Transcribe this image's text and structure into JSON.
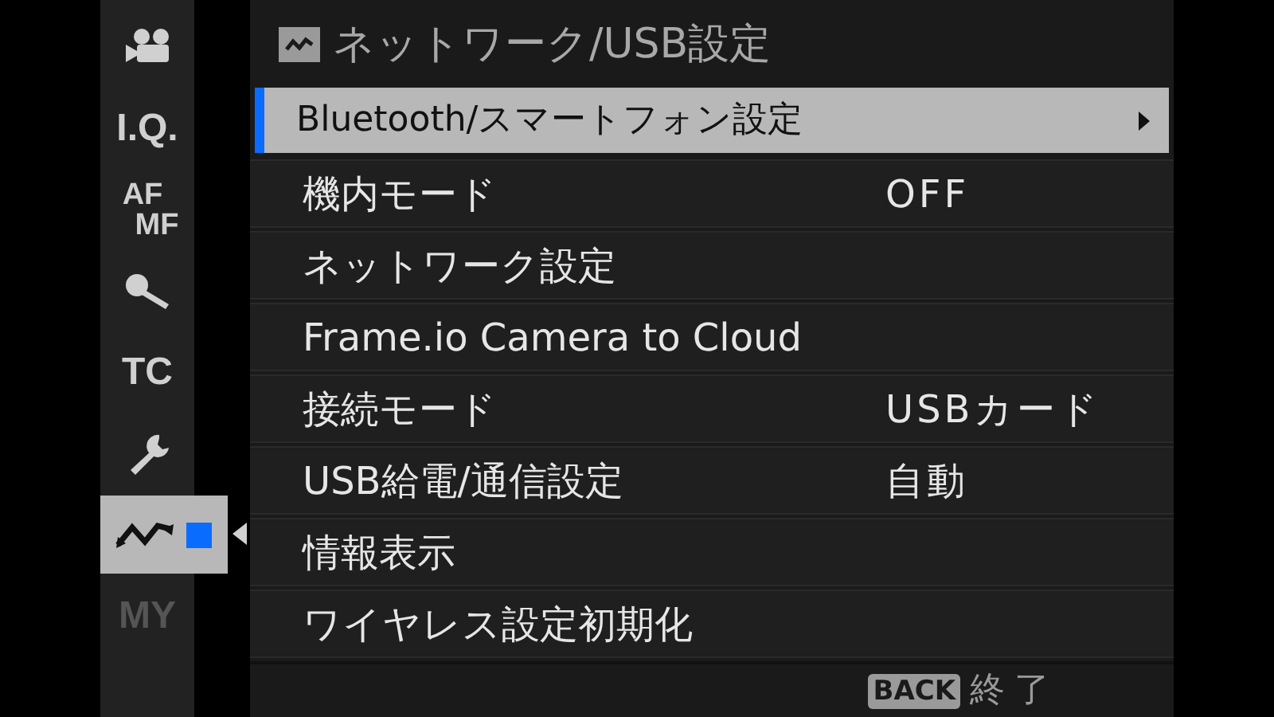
{
  "sidebar": {
    "tabs": [
      {
        "kind": "movie",
        "selected": false,
        "disabled": false
      },
      {
        "kind": "text",
        "lines": [
          "I.Q."
        ],
        "selected": false,
        "disabled": false
      },
      {
        "kind": "text",
        "lines": [
          "AF",
          "MF"
        ],
        "selected": false,
        "disabled": false
      },
      {
        "kind": "mic",
        "selected": false,
        "disabled": false
      },
      {
        "kind": "text",
        "lines": [
          "TC"
        ],
        "selected": false,
        "disabled": false
      },
      {
        "kind": "wrench",
        "selected": false,
        "disabled": false
      },
      {
        "kind": "network",
        "selected": true,
        "disabled": false
      },
      {
        "kind": "text",
        "lines": [
          "MY"
        ],
        "selected": false,
        "disabled": true
      }
    ]
  },
  "header": {
    "title": "ネットワーク/USB設定"
  },
  "menu": {
    "rows": [
      {
        "label": "Bluetooth/スマートフォン設定",
        "selected": true,
        "submenu": true
      },
      {
        "label": "機内モード",
        "value": "OFF",
        "selected": false,
        "submenu": false
      },
      {
        "label": "ネットワーク設定",
        "selected": false,
        "submenu": false
      },
      {
        "label": "Frame.io Camera to Cloud",
        "selected": false,
        "submenu": false
      },
      {
        "label": "接続モード",
        "value": "USBカード",
        "selected": false,
        "submenu": false
      },
      {
        "label": "USB給電/通信設定",
        "value": "自動",
        "selected": false,
        "submenu": false
      },
      {
        "label": "情報表示",
        "selected": false,
        "submenu": false
      },
      {
        "label": "ワイヤレス設定初期化",
        "selected": false,
        "submenu": false
      }
    ]
  },
  "footer": {
    "key": "BACK",
    "action": "終了"
  }
}
